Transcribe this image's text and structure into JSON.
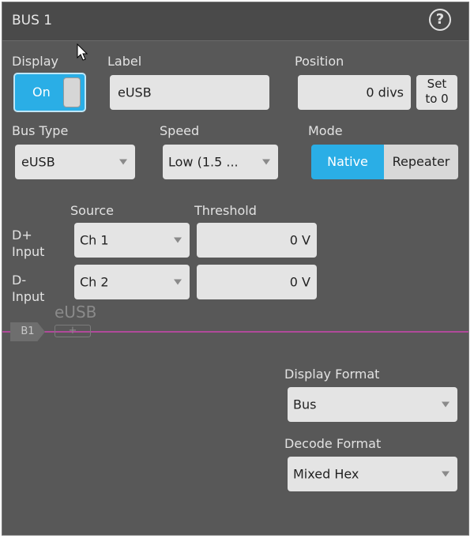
{
  "window": {
    "title": "BUS 1",
    "help_glyph": "?"
  },
  "display": {
    "label": "Display",
    "toggle_value": "On"
  },
  "label_field": {
    "label": "Label",
    "value": "eUSB"
  },
  "position": {
    "label": "Position",
    "value": "0 divs",
    "set_zero_line1": "Set",
    "set_zero_line2": "to 0"
  },
  "bus_type": {
    "label": "Bus Type",
    "value": "eUSB"
  },
  "speed": {
    "label": "Speed",
    "value": "Low (1.5 ..."
  },
  "mode": {
    "label": "Mode",
    "native": "Native",
    "repeater": "Repeater",
    "selected": "Native"
  },
  "inputs": {
    "source_header": "Source",
    "threshold_header": "Threshold",
    "dplus": {
      "label_line1": "D+",
      "label_line2": "Input",
      "source": "Ch 1",
      "threshold": "0 V"
    },
    "dminus": {
      "label_line1": "D-",
      "label_line2": "Input",
      "source": "Ch 2",
      "threshold": "0 V"
    }
  },
  "waveform": {
    "bus_tag": "B1",
    "bus_name": "eUSB",
    "plus_glyph": "+",
    "color": "#b04a9a"
  },
  "display_format": {
    "label": "Display Format",
    "value": "Bus"
  },
  "decode_format": {
    "label": "Decode Format",
    "value": "Mixed Hex"
  },
  "colors": {
    "accent": "#2aaee6",
    "panel": "#585858",
    "field": "#e4e4e4"
  }
}
